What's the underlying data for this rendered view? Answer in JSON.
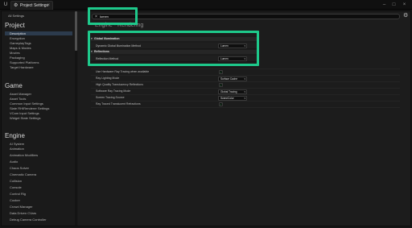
{
  "titlebar": {
    "logo_icon": "unreal-logo-icon",
    "tab_icon": "gear-icon",
    "tab_label": "Project Settings",
    "close_symbol": "×",
    "minimize_symbol": "–",
    "maximize_symbol": "□",
    "window_close_symbol": "×"
  },
  "sidebar": {
    "all_settings": "All Settings",
    "categories": [
      {
        "title": "Project",
        "items": [
          "Description",
          "Encryption",
          "GameplayTags",
          "Maps & Modes",
          "Movies",
          "Packaging",
          "Supported Platforms",
          "Target Hardware"
        ],
        "selected": "Description"
      },
      {
        "title": "Game",
        "items": [
          "Asset Manager",
          "Asset Tools",
          "Common Input Settings",
          "Slate RHIRenderer Settings",
          "VCam Input Settings",
          "Widget State Settings"
        ]
      },
      {
        "title": "Engine",
        "items": [
          "AI System",
          "Animation",
          "Animation Modifiers",
          "Audio",
          "Chaos Solver",
          "Cinematic Camera",
          "Collision",
          "Console",
          "Control Rig",
          "Cooker",
          "Crowd Manager",
          "Data Driven CVars",
          "Debug Camera Controller"
        ]
      }
    ]
  },
  "search": {
    "clear_symbol": "×",
    "value": "lumen"
  },
  "settings_icon": "gear-icon",
  "section_title": "Engine - Rendering",
  "groups": [
    {
      "label": "Global Illumination",
      "rows": [
        {
          "label": "Dynamic Global Illumination Method",
          "value": "Lumen"
        }
      ]
    },
    {
      "label": "Reflections",
      "rows": [
        {
          "label": "Reflection Method",
          "value": "Lumen"
        }
      ]
    }
  ],
  "settings": [
    {
      "label": "Use Hardware Ray Tracing when available",
      "type": "checkbox",
      "checked": true
    },
    {
      "label": "Ray Lighting Mode",
      "type": "dropdown",
      "value": "Surface Cache"
    },
    {
      "label": "High Quality Translucency Reflections",
      "type": "checkbox",
      "checked": true
    },
    {
      "label": "Software Ray Tracing Mode",
      "type": "dropdown",
      "value": "Global Tracing"
    },
    {
      "label": "Screen Tracing Source",
      "type": "dropdown",
      "value": "SceneColor"
    },
    {
      "label": "Ray Traced Translucent Refractions",
      "type": "checkbox",
      "checked": true
    }
  ],
  "colors": {
    "highlight": "#1ec98b",
    "check": "#2ea44f",
    "selection": "#2c3b4d"
  }
}
